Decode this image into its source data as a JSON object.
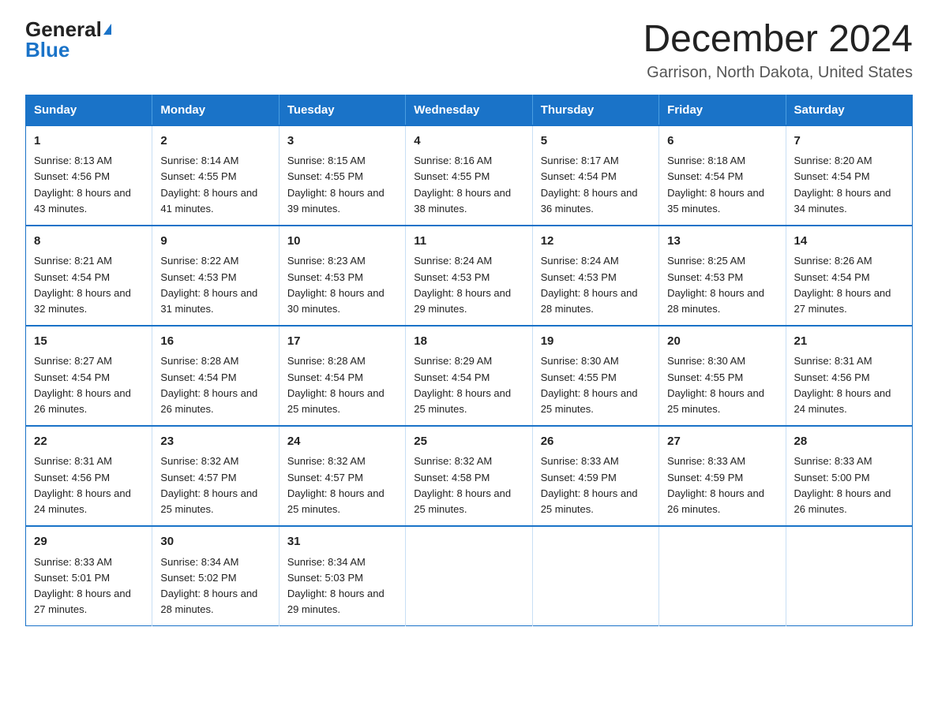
{
  "logo": {
    "general": "General",
    "triangle": "▲",
    "blue": "Blue"
  },
  "title": "December 2024",
  "subtitle": "Garrison, North Dakota, United States",
  "weekdays": [
    "Sunday",
    "Monday",
    "Tuesday",
    "Wednesday",
    "Thursday",
    "Friday",
    "Saturday"
  ],
  "weeks": [
    [
      {
        "day": "1",
        "sunrise": "8:13 AM",
        "sunset": "4:56 PM",
        "daylight": "8 hours and 43 minutes."
      },
      {
        "day": "2",
        "sunrise": "8:14 AM",
        "sunset": "4:55 PM",
        "daylight": "8 hours and 41 minutes."
      },
      {
        "day": "3",
        "sunrise": "8:15 AM",
        "sunset": "4:55 PM",
        "daylight": "8 hours and 39 minutes."
      },
      {
        "day": "4",
        "sunrise": "8:16 AM",
        "sunset": "4:55 PM",
        "daylight": "8 hours and 38 minutes."
      },
      {
        "day": "5",
        "sunrise": "8:17 AM",
        "sunset": "4:54 PM",
        "daylight": "8 hours and 36 minutes."
      },
      {
        "day": "6",
        "sunrise": "8:18 AM",
        "sunset": "4:54 PM",
        "daylight": "8 hours and 35 minutes."
      },
      {
        "day": "7",
        "sunrise": "8:20 AM",
        "sunset": "4:54 PM",
        "daylight": "8 hours and 34 minutes."
      }
    ],
    [
      {
        "day": "8",
        "sunrise": "8:21 AM",
        "sunset": "4:54 PM",
        "daylight": "8 hours and 32 minutes."
      },
      {
        "day": "9",
        "sunrise": "8:22 AM",
        "sunset": "4:53 PM",
        "daylight": "8 hours and 31 minutes."
      },
      {
        "day": "10",
        "sunrise": "8:23 AM",
        "sunset": "4:53 PM",
        "daylight": "8 hours and 30 minutes."
      },
      {
        "day": "11",
        "sunrise": "8:24 AM",
        "sunset": "4:53 PM",
        "daylight": "8 hours and 29 minutes."
      },
      {
        "day": "12",
        "sunrise": "8:24 AM",
        "sunset": "4:53 PM",
        "daylight": "8 hours and 28 minutes."
      },
      {
        "day": "13",
        "sunrise": "8:25 AM",
        "sunset": "4:53 PM",
        "daylight": "8 hours and 28 minutes."
      },
      {
        "day": "14",
        "sunrise": "8:26 AM",
        "sunset": "4:54 PM",
        "daylight": "8 hours and 27 minutes."
      }
    ],
    [
      {
        "day": "15",
        "sunrise": "8:27 AM",
        "sunset": "4:54 PM",
        "daylight": "8 hours and 26 minutes."
      },
      {
        "day": "16",
        "sunrise": "8:28 AM",
        "sunset": "4:54 PM",
        "daylight": "8 hours and 26 minutes."
      },
      {
        "day": "17",
        "sunrise": "8:28 AM",
        "sunset": "4:54 PM",
        "daylight": "8 hours and 25 minutes."
      },
      {
        "day": "18",
        "sunrise": "8:29 AM",
        "sunset": "4:54 PM",
        "daylight": "8 hours and 25 minutes."
      },
      {
        "day": "19",
        "sunrise": "8:30 AM",
        "sunset": "4:55 PM",
        "daylight": "8 hours and 25 minutes."
      },
      {
        "day": "20",
        "sunrise": "8:30 AM",
        "sunset": "4:55 PM",
        "daylight": "8 hours and 25 minutes."
      },
      {
        "day": "21",
        "sunrise": "8:31 AM",
        "sunset": "4:56 PM",
        "daylight": "8 hours and 24 minutes."
      }
    ],
    [
      {
        "day": "22",
        "sunrise": "8:31 AM",
        "sunset": "4:56 PM",
        "daylight": "8 hours and 24 minutes."
      },
      {
        "day": "23",
        "sunrise": "8:32 AM",
        "sunset": "4:57 PM",
        "daylight": "8 hours and 25 minutes."
      },
      {
        "day": "24",
        "sunrise": "8:32 AM",
        "sunset": "4:57 PM",
        "daylight": "8 hours and 25 minutes."
      },
      {
        "day": "25",
        "sunrise": "8:32 AM",
        "sunset": "4:58 PM",
        "daylight": "8 hours and 25 minutes."
      },
      {
        "day": "26",
        "sunrise": "8:33 AM",
        "sunset": "4:59 PM",
        "daylight": "8 hours and 25 minutes."
      },
      {
        "day": "27",
        "sunrise": "8:33 AM",
        "sunset": "4:59 PM",
        "daylight": "8 hours and 26 minutes."
      },
      {
        "day": "28",
        "sunrise": "8:33 AM",
        "sunset": "5:00 PM",
        "daylight": "8 hours and 26 minutes."
      }
    ],
    [
      {
        "day": "29",
        "sunrise": "8:33 AM",
        "sunset": "5:01 PM",
        "daylight": "8 hours and 27 minutes."
      },
      {
        "day": "30",
        "sunrise": "8:34 AM",
        "sunset": "5:02 PM",
        "daylight": "8 hours and 28 minutes."
      },
      {
        "day": "31",
        "sunrise": "8:34 AM",
        "sunset": "5:03 PM",
        "daylight": "8 hours and 29 minutes."
      },
      null,
      null,
      null,
      null
    ]
  ]
}
